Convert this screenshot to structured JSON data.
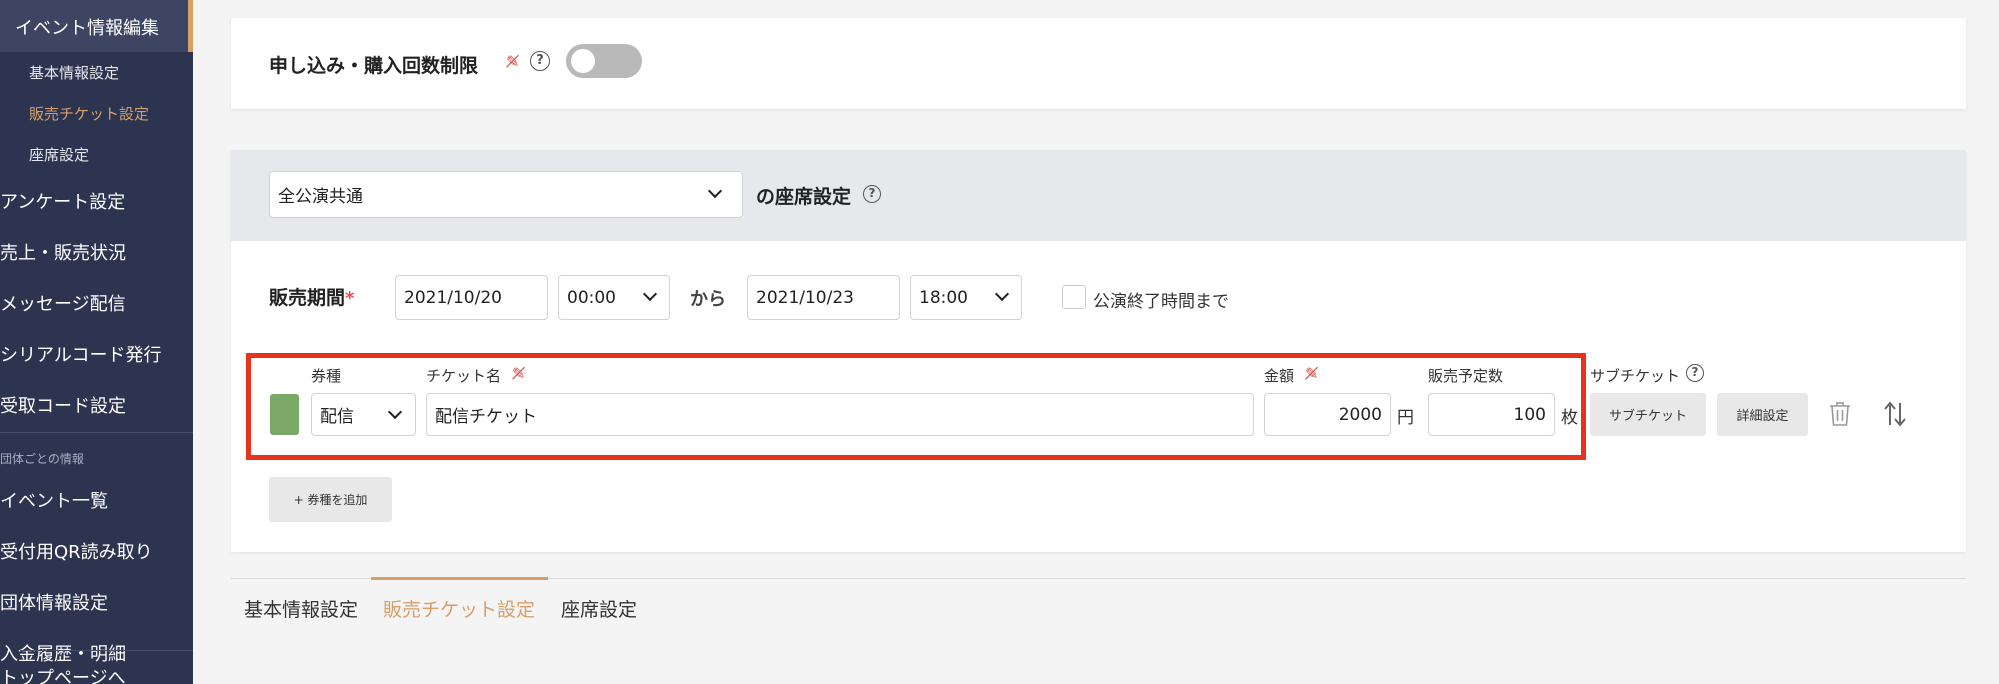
{
  "sidebar": {
    "active": "イベント情報編集",
    "sub_items": [
      "基本情報設定",
      "販売チケット設定",
      "座席設定"
    ],
    "items_event": [
      "アンケート設定",
      "売上・販売状況",
      "メッセージ配信",
      "シリアルコード発行",
      "受取コード設定"
    ],
    "section_label": "団体ごとの情報",
    "items_group": [
      "イベント一覧",
      "受付用QR読み取り",
      "団体情報設定",
      "入金履歴・明細",
      "トップページへ"
    ]
  },
  "limit": {
    "title": "申し込み・購入回数制限",
    "help": "?"
  },
  "seat": {
    "select_value": "全公演共通",
    "suffix": "の座席設定",
    "help": "?"
  },
  "period": {
    "label": "販売期間",
    "required_mark": "*",
    "start_date": "2021/10/20",
    "start_time": "00:00",
    "from_label": "から",
    "end_date": "2021/10/23",
    "end_time": "18:00",
    "until_end_label": "公演終了時間まで"
  },
  "ticket": {
    "col_type": "券種",
    "col_name": "チケット名",
    "col_price": "金額",
    "col_qty": "販売予定数",
    "col_sub": "サブチケット",
    "help": "?",
    "type_value": "配信",
    "name_value": "配信チケット",
    "price_value": "2000",
    "price_unit": "円",
    "qty_value": "100",
    "qty_unit": "枚",
    "sub_button": "サブチケット",
    "detail_button": "詳細設定",
    "swatch_color": "#7aa866"
  },
  "add_button": "+ 券種を追加",
  "tabs": [
    "基本情報設定",
    "販売チケット設定",
    "座席設定"
  ],
  "colors": {
    "accent": "#d6a06a",
    "sidebar": "#2c3450",
    "highlight": "#e8321b"
  }
}
